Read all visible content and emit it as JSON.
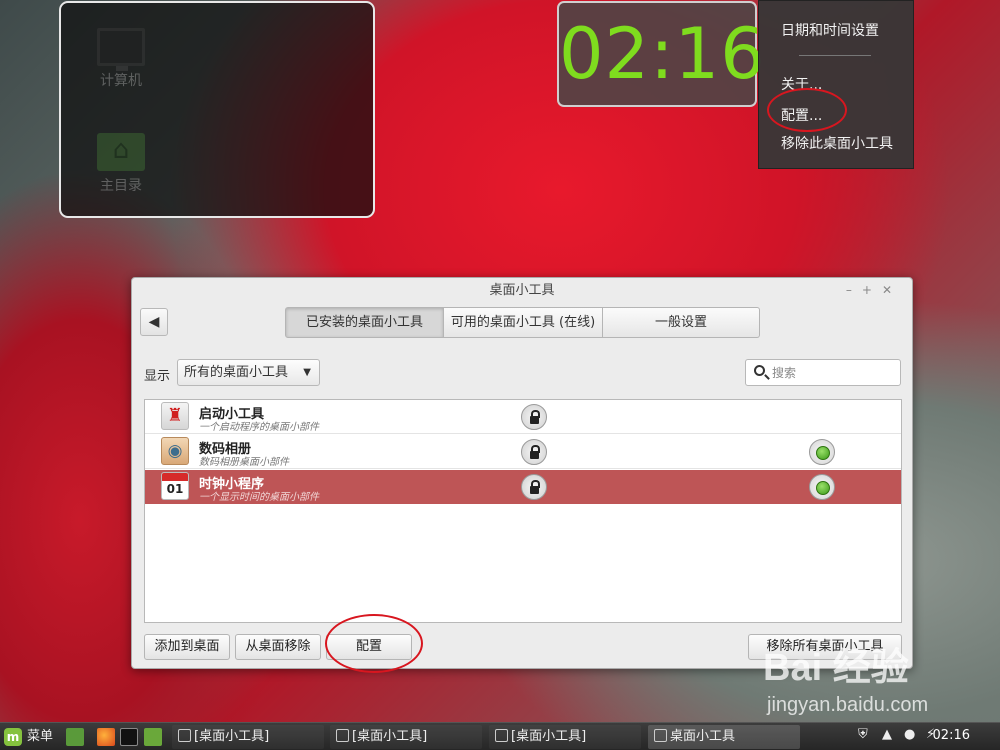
{
  "desktop": {
    "icons": [
      {
        "label": "计算机",
        "icon": "computer-icon"
      },
      {
        "label": "主目录",
        "icon": "home-folder-icon"
      }
    ]
  },
  "clock_desklet": {
    "time": "02:16"
  },
  "context_menu": {
    "items": [
      {
        "label": "日期和时间设置"
      },
      {
        "label": "关于..."
      },
      {
        "label": "配置..."
      },
      {
        "label": "移除此桌面小工具"
      }
    ]
  },
  "window": {
    "title": "桌面小工具",
    "tabs": [
      {
        "label": "已安装的桌面小工具",
        "active": true
      },
      {
        "label": "可用的桌面小工具 (在线)",
        "active": false
      },
      {
        "label": "一般设置",
        "active": false
      }
    ],
    "filter": {
      "label": "显示",
      "selected": "所有的桌面小工具"
    },
    "search": {
      "placeholder": "搜索"
    },
    "desklets": [
      {
        "name": "启动小工具",
        "description": "一个启动程序的桌面小部件",
        "icon": "rocket-icon",
        "locked": true,
        "active": false,
        "selected": false
      },
      {
        "name": "数码相册",
        "description": "数码相册桌面小部件",
        "icon": "eye-icon",
        "locked": true,
        "active": true,
        "selected": false
      },
      {
        "name": "时钟小程序",
        "description": "一个显示时间的桌面小部件",
        "icon": "calendar-icon",
        "calendar_day": "01",
        "locked": true,
        "active": true,
        "selected": true
      }
    ],
    "buttons": {
      "add": "添加到桌面",
      "remove": "从桌面移除",
      "configure": "配置",
      "remove_all": "移除所有桌面小工具"
    }
  },
  "taskbar": {
    "menu_label": "菜单",
    "tasks": [
      {
        "label": "[桌面小工具]",
        "active": false
      },
      {
        "label": "[桌面小工具]",
        "active": false
      },
      {
        "label": "[桌面小工具]",
        "active": false
      },
      {
        "label": "桌面小工具",
        "active": true
      }
    ],
    "clock": "02:16"
  },
  "watermark": {
    "brand": "Bai 经验",
    "url": "jingyan.baidu.com"
  },
  "colors": {
    "clock_green": "#7fdc1e",
    "selected_row": "#be5556",
    "annotation_red": "#d8161f"
  }
}
